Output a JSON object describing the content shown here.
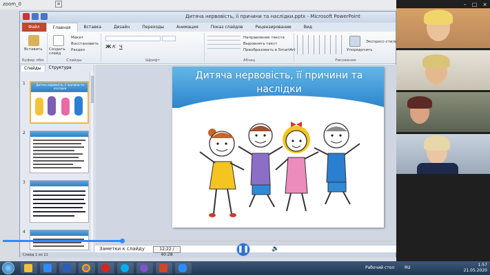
{
  "meeting": {
    "title": "zoom_0"
  },
  "window": {
    "title": "Дитяча нервовість, її причини та наслідки.pptx - Microsoft PowerPoint",
    "controls": [
      "–",
      "□",
      "×"
    ]
  },
  "ribbon_tabs": [
    {
      "label": "Файл"
    },
    {
      "label": "Главная"
    },
    {
      "label": "Вставка"
    },
    {
      "label": "Дизайн"
    },
    {
      "label": "Переходы"
    },
    {
      "label": "Анимация"
    },
    {
      "label": "Показ слайдов"
    },
    {
      "label": "Рецензирование"
    },
    {
      "label": "Вид"
    }
  ],
  "ribbon": {
    "paste": "Вставить",
    "create_slide": "Создать слайд",
    "layout": "Макет",
    "reset": "Восстановить",
    "section": "Раздел",
    "text_direction": "Направление текста",
    "align_text": "Выровнять текст",
    "smartart": "Преобразовать в SmartArt",
    "arrange": "Упорядочить",
    "quick_styles": "Экспресс-стили",
    "groups": {
      "clipboard": "Буфер обм.",
      "slides": "Слайды",
      "font": "Шрифт",
      "paragraph": "Абзац",
      "drawing": "Рисование"
    }
  },
  "panel_tabs": {
    "slides": "Слайды",
    "outline": "Структура"
  },
  "thumbnails": [
    {
      "num": "1",
      "title": "Дитяча нервовість, її причини та наслідки"
    },
    {
      "num": "2"
    },
    {
      "num": "3"
    },
    {
      "num": "4"
    }
  ],
  "slide": {
    "title": "Дитяча нервовість, її причини та наслідки"
  },
  "notes": {
    "placeholder": "Заметки к слайду"
  },
  "statusbar": {
    "left": "Слайд 1 из 11"
  },
  "player": {
    "time": "12:22 / 40:28",
    "progress": 0.305
  },
  "taskbar": {
    "desktop_label": "Рабочий стол",
    "lang": "RU",
    "clock": "1:57",
    "date": "21.05.2020"
  },
  "colors": {
    "slide_header": "#2d86cc",
    "accent_blue": "#2f8bff",
    "file_tab": "#c4462c"
  }
}
